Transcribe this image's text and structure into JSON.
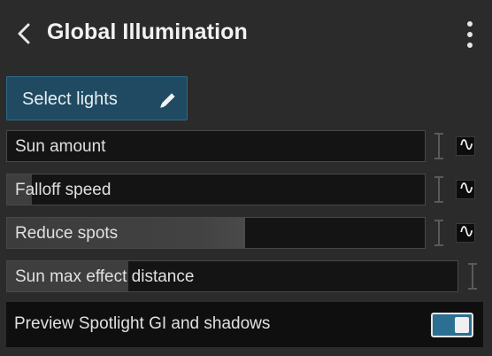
{
  "header": {
    "title": "Global Illumination",
    "back_icon": "chevron-left-icon",
    "menu_icon": "more-vertical-icon"
  },
  "select_lights": {
    "label": "Select lights",
    "icon": "pencil-icon"
  },
  "sliders": [
    {
      "label": "Sun amount",
      "value": 0.0
    },
    {
      "label": "Falloff speed",
      "value": 0.06
    },
    {
      "label": "Reduce spots",
      "value": 0.57
    },
    {
      "label": "Sun max effect distance",
      "value": 0.27
    }
  ],
  "preview": {
    "label": "Preview Spotlight GI and shadows",
    "toggle_on": true
  },
  "colors": {
    "accent": "#2b6f93",
    "button_bg": "#1f4a61",
    "background": "#2b2b2b"
  }
}
